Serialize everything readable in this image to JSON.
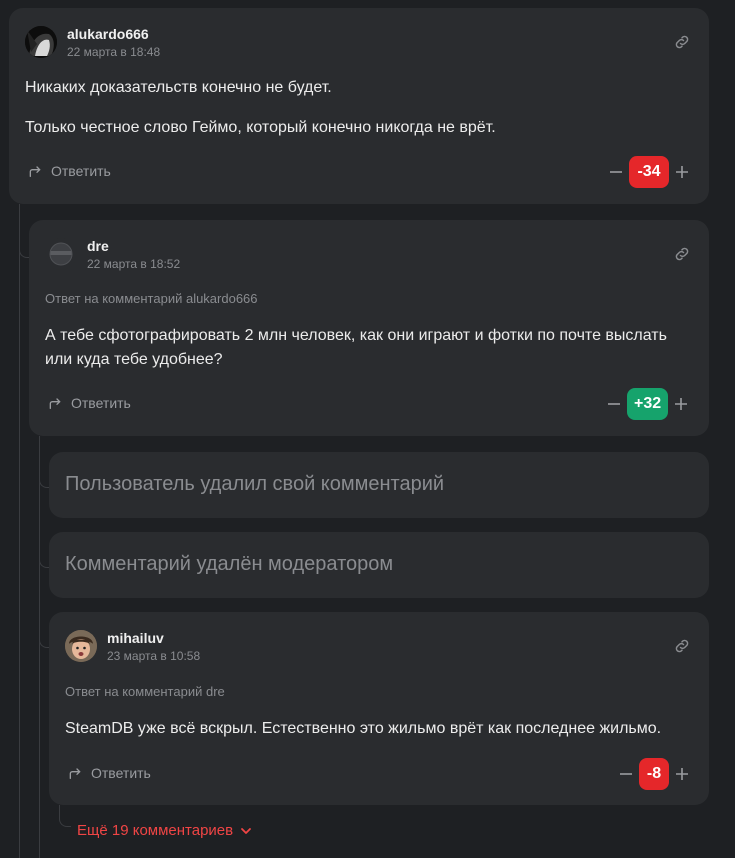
{
  "comments": [
    {
      "author": "alukardo666",
      "date": "22 марта в 18:48",
      "paragraphs": [
        "Никаких доказательств конечно не будет.",
        "Только честное слово Геймо, который конечно никогда не врёт."
      ],
      "reply_label": "Ответить",
      "score": "-34"
    },
    {
      "author": "dre",
      "date": "22 марта в 18:52",
      "reply_to": "Ответ на комментарий alukardo666",
      "text": "А тебе сфотографировать 2 млн человек, как они играют и фотки по почте выслать или куда тебе удобнее?",
      "reply_label": "Ответить",
      "score": "+32"
    },
    {
      "deleted_text": "Пользователь удалил свой комментарий"
    },
    {
      "deleted_text": "Комментарий удалён модератором"
    },
    {
      "author": "mihailuv",
      "date": "23 марта в 10:58",
      "reply_to": "Ответ на комментарий dre",
      "text": "SteamDB уже всё вскрыл. Естественно это жильмо врёт как последнее жильмо.",
      "reply_label": "Ответить",
      "score": "-8"
    }
  ],
  "more_comments": "Ещё 19 комментариев",
  "colors": {
    "background": "#1e2023",
    "card": "#2a2c2f",
    "negative": "#e5272a",
    "positive": "#16a36c",
    "more_link": "#f04545"
  },
  "icons": {
    "link": "link-icon",
    "reply": "reply-arrow-icon",
    "downvote": "minus-icon",
    "upvote": "plus-icon",
    "expand": "chevron-down-icon"
  }
}
